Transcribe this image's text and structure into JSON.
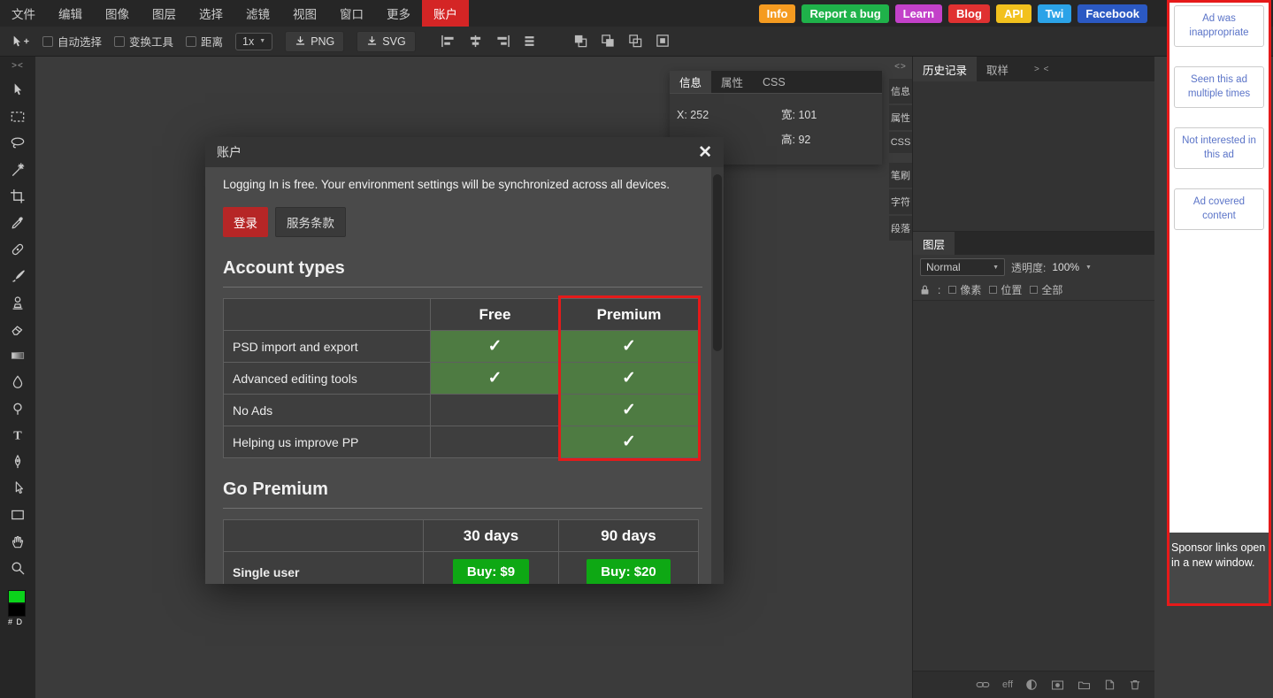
{
  "menubar": {
    "items": [
      "文件",
      "编辑",
      "图像",
      "图层",
      "选择",
      "滤镜",
      "视图",
      "窗口",
      "更多",
      "账户"
    ],
    "active_item": "账户",
    "active_bg": "#d42525",
    "links": [
      {
        "label": "Info",
        "bg": "#f59b20"
      },
      {
        "label": "Report a bug",
        "bg": "#1fb24a"
      },
      {
        "label": "Learn",
        "bg": "#c341c9"
      },
      {
        "label": "Blog",
        "bg": "#e03131"
      },
      {
        "label": "API",
        "bg": "#f2c11d"
      },
      {
        "label": "Twi",
        "bg": "#2ba3e8"
      },
      {
        "label": "Facebook",
        "bg": "#2b59c3"
      }
    ]
  },
  "options_bar": {
    "checkboxes": [
      {
        "label": "自动选择",
        "checked": false
      },
      {
        "label": "变换工具",
        "checked": false
      },
      {
        "label": "距离",
        "checked": false
      }
    ],
    "zoom_value": "1x",
    "export_png": "PNG",
    "export_svg": "SVG"
  },
  "tool_panel": {
    "collapse": "><",
    "tools": [
      "move-tool",
      "marquee-select-tool",
      "lasso-tool",
      "magic-wand-tool",
      "crop-tool",
      "eyedropper-tool",
      "healing-tool",
      "brush-tool",
      "clone-stamp-tool",
      "eraser-tool",
      "gradient-tool",
      "blur-tool",
      "dodge-tool",
      "type-tool",
      "pen-tool",
      "path-select-tool",
      "rectangle-tool",
      "hand-tool",
      "zoom-tool"
    ],
    "foreground_color": "#0bd31b",
    "background_color": "#000000",
    "swatch_label": "# D"
  },
  "info_panel": {
    "tabs": [
      "信息",
      "属性",
      "CSS"
    ],
    "active_tab": "信息",
    "x_label": "X:",
    "x_value": "252",
    "w_label": "宽:",
    "w_value": "101",
    "h_label": "高:",
    "h_value": "92"
  },
  "dialog": {
    "title": "账户",
    "close": "✕",
    "intro": "Logging In is free. Your environment settings will be synchronized across all devices.",
    "login_button": "登录",
    "terms_button": "服务条款",
    "check": "✓",
    "account_types": {
      "heading": "Account types",
      "columns": [
        "",
        "Free",
        "Premium"
      ],
      "rows": [
        {
          "label": "PSD import and export",
          "free": true,
          "premium": true
        },
        {
          "label": "Advanced editing tools",
          "free": true,
          "premium": true
        },
        {
          "label": "No Ads",
          "free": false,
          "premium": true
        },
        {
          "label": "Helping us improve PP",
          "free": false,
          "premium": true
        }
      ],
      "check_bg": "#4e7b42",
      "highlight_border": "#e51a1a"
    },
    "go_premium": {
      "heading": "Go Premium",
      "columns": [
        "",
        "30 days",
        "90 days"
      ],
      "row_label": "Single user",
      "buy_30": "Buy: $9",
      "buy_90": "Buy: $20",
      "button_bg": "#0ea814"
    }
  },
  "right_rail": {
    "strip_collapse": "<>",
    "strip_tabs": [
      "信息",
      "属性",
      "CSS",
      "笔刷",
      "字符",
      "段落"
    ],
    "top_tabs": [
      "历史记录",
      "取样"
    ],
    "active_top_tab": "历史记录",
    "top_collapse": "> <",
    "layers": {
      "tab": "图层",
      "blend_mode": "Normal",
      "opacity_label": "透明度:",
      "opacity_value": "100%",
      "lock_separator": ":",
      "lock_items": [
        "像素",
        "位置",
        "全部"
      ],
      "effects_label": "eff"
    }
  },
  "ad_panel": {
    "border_color": "#e61a1a",
    "link_color": "#5b74c8",
    "buttons": [
      "Ad was inappropriate",
      "Seen this ad multiple times",
      "Not interested in this ad",
      "Ad covered content"
    ],
    "footer": "Sponsor links open in a new window."
  }
}
